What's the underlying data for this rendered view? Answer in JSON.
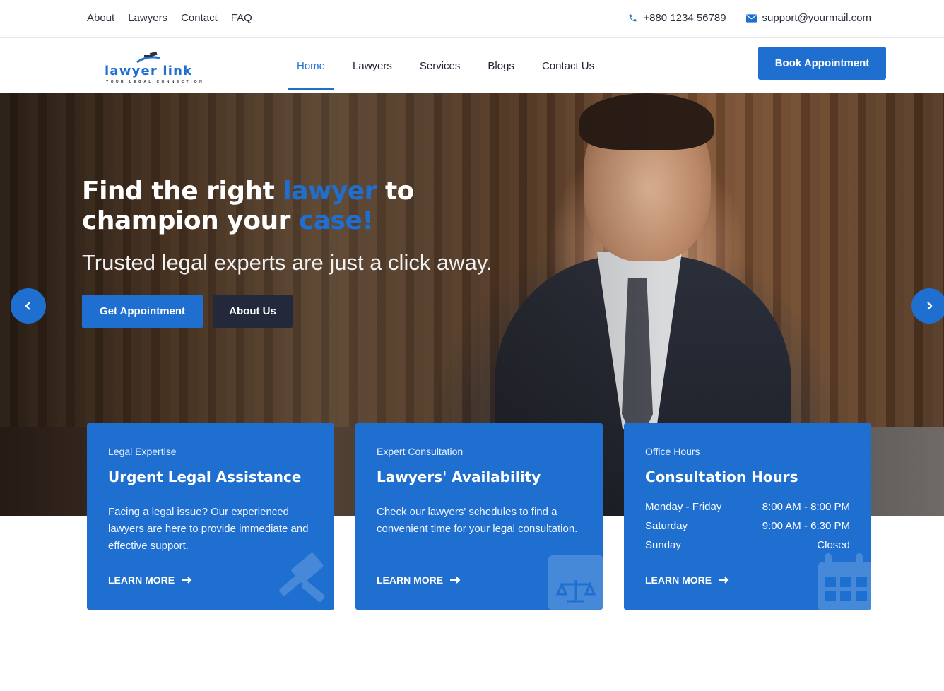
{
  "topbar": {
    "links": [
      "About",
      "Lawyers",
      "Contact",
      "FAQ"
    ],
    "phone": "+880 1234 56789",
    "email": "support@yourmail.com"
  },
  "header": {
    "logo_text": "lawyer link",
    "logo_tagline": "YOUR LEGAL CONNECTION",
    "nav": [
      "Home",
      "Lawyers",
      "Services",
      "Blogs",
      "Contact Us"
    ],
    "active_nav": "Home",
    "cta": "Book Appointment"
  },
  "hero": {
    "title_a": "Find the right ",
    "title_hl1": "lawyer",
    "title_b": " to",
    "title_c": "champion your ",
    "title_hl2": "case!",
    "subtitle": "Trusted legal experts are just a click away.",
    "primary_button": "Get Appointment",
    "secondary_button": "About Us"
  },
  "cards": [
    {
      "eyebrow": "Legal Expertise",
      "title": "Urgent Legal Assistance",
      "text": "Facing a legal issue? Our experienced lawyers are here to provide immediate and effective support.",
      "link": "LEARN MORE",
      "icon": "gavel-icon"
    },
    {
      "eyebrow": "Expert Consultation",
      "title": "Lawyers' Availability",
      "text": "Check our lawyers' schedules to find a convenient time for your legal consultation.",
      "link": "LEARN MORE",
      "icon": "law-book-icon"
    },
    {
      "eyebrow": "Office Hours",
      "title": "Consultation Hours",
      "hours": [
        {
          "day": "Monday - Friday",
          "time": "8:00 AM - 8:00 PM"
        },
        {
          "day": "Saturday",
          "time": "9:00 AM - 6:30 PM"
        },
        {
          "day": "Sunday",
          "time": "Closed"
        }
      ],
      "link": "LEARN MORE",
      "icon": "calendar-icon"
    }
  ],
  "colors": {
    "accent": "#1e6fd0",
    "dark_button": "#23283a"
  }
}
